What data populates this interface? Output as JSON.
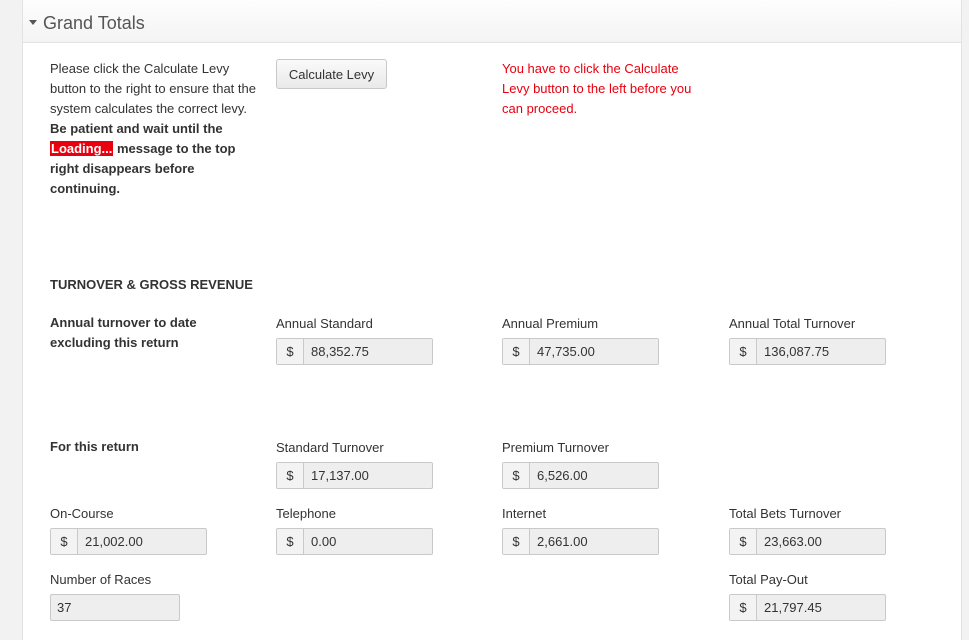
{
  "section": {
    "title": "Grand Totals"
  },
  "instructions": {
    "part1": "Please click the Calculate Levy button to the right to ensure that the system calculates the correct levy. ",
    "bold1": "Be patient and wait until the ",
    "loading": "Loading...",
    "bold2": " message to the top right disappears before continuing."
  },
  "calculate_button": "Calculate Levy",
  "warning": "You have to click the Calculate Levy button to the left before you can proceed.",
  "turnover": {
    "heading": "TURNOVER & GROSS REVENUE",
    "annual_label": "Annual turnover to date excluding this return",
    "annual_standard": {
      "label": "Annual Standard",
      "currency": "$",
      "value": "88,352.75"
    },
    "annual_premium": {
      "label": "Annual Premium",
      "currency": "$",
      "value": "47,735.00"
    },
    "annual_total": {
      "label": "Annual Total Turnover",
      "currency": "$",
      "value": "136,087.75"
    },
    "return_label": "For this return",
    "standard_turnover": {
      "label": "Standard Turnover",
      "currency": "$",
      "value": "17,137.00"
    },
    "premium_turnover": {
      "label": "Premium Turnover",
      "currency": "$",
      "value": "6,526.00"
    },
    "on_course": {
      "label": "On-Course",
      "currency": "$",
      "value": "21,002.00"
    },
    "telephone": {
      "label": "Telephone",
      "currency": "$",
      "value": "0.00"
    },
    "internet": {
      "label": "Internet",
      "currency": "$",
      "value": "2,661.00"
    },
    "total_bets": {
      "label": "Total Bets Turnover",
      "currency": "$",
      "value": "23,663.00"
    },
    "races": {
      "label": "Number of Races",
      "value": "37"
    },
    "payout": {
      "label": "Total Pay-Out",
      "currency": "$",
      "value": "21,797.45"
    }
  }
}
